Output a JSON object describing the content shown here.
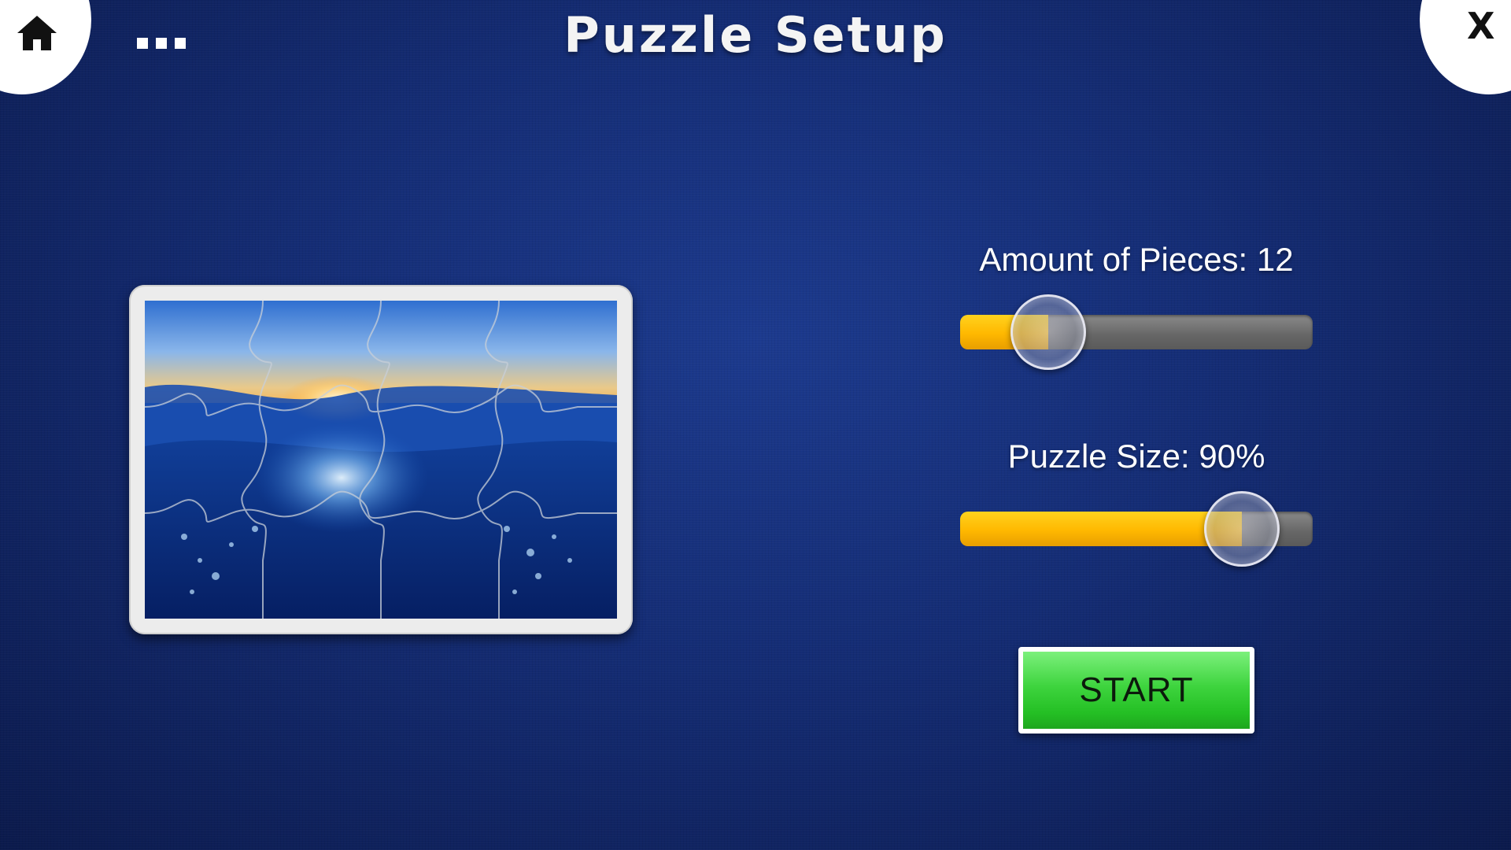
{
  "header": {
    "title": "Puzzle Setup",
    "home_icon": "home-icon",
    "menu_icon": "more-dots-icon",
    "close_label": "X"
  },
  "preview": {
    "image_description_icon": "puzzle-preview-image"
  },
  "controls": {
    "pieces_label": "Amount of Pieces: 12",
    "pieces_level": 0.25,
    "size_label": "Puzzle Size: 90%",
    "size_level": 0.8
  },
  "actions": {
    "start_label": "START"
  },
  "colors": {
    "background": "#142c74",
    "slider_fill": "#ffb800",
    "slider_track": "#6a6a6a",
    "start_button": "#3ed43e"
  }
}
